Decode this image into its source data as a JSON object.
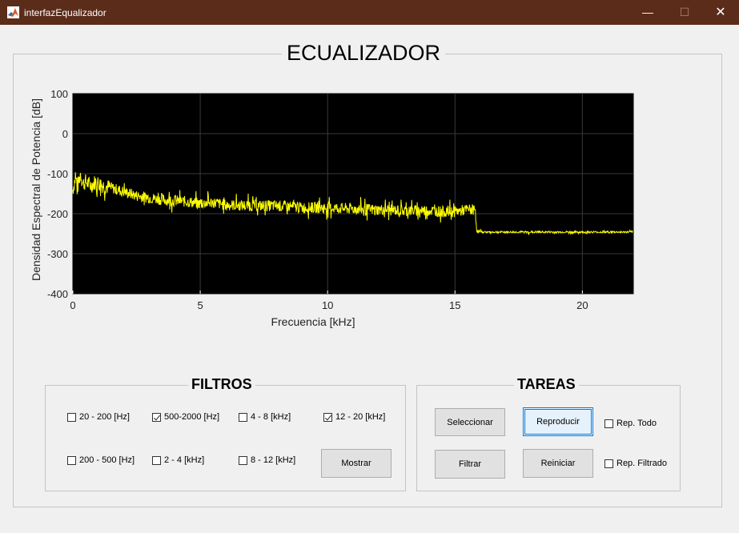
{
  "window": {
    "title": "interfazEqualizador",
    "minimize_icon": "—",
    "maximize_icon": "☐",
    "close_icon": "✕"
  },
  "main_title": "ECUALIZADOR",
  "chart_data": {
    "type": "line",
    "xlabel": "Frecuencia [kHz]",
    "ylabel": "Densidad Espectral de Potencia [dB]",
    "xlim": [
      0,
      22
    ],
    "ylim": [
      -400,
      100
    ],
    "xticks": [
      0,
      5,
      10,
      15,
      20
    ],
    "yticks": [
      100,
      0,
      -100,
      -200,
      -300,
      -400
    ],
    "grid": true,
    "background": "#000000",
    "line_color": "#ffff00",
    "series": [
      {
        "x": [
          0,
          0.1,
          0.2,
          0.3,
          0.4,
          0.5,
          0.7,
          0.9,
          1.2,
          1.5,
          2,
          2.5,
          3,
          3.5,
          4,
          4.5,
          5,
          5.5,
          6,
          7,
          8,
          9,
          10,
          11,
          12,
          13,
          14,
          14.5,
          15,
          15.5,
          15.8,
          15.85,
          15.9,
          16,
          16.2,
          16.5,
          17,
          18,
          19,
          20,
          21,
          22
        ],
        "y": [
          -140,
          -110,
          -130,
          -100,
          -125,
          -120,
          -130,
          -120,
          -130,
          -135,
          -145,
          -155,
          -160,
          -165,
          -168,
          -170,
          -175,
          -172,
          -178,
          -180,
          -180,
          -185,
          -185,
          -188,
          -190,
          -192,
          -192,
          -195,
          -195,
          -190,
          -190,
          -240,
          -245,
          -245,
          -246,
          -246,
          -246,
          -246,
          -246,
          -246,
          -246,
          -246
        ]
      }
    ]
  },
  "filtros": {
    "title": "FILTROS",
    "checkboxes": [
      {
        "label": "20 - 200 [Hz]",
        "checked": false
      },
      {
        "label": "500-2000 [Hz]",
        "checked": true
      },
      {
        "label": "4 - 8 [kHz]",
        "checked": false
      },
      {
        "label": "12 - 20 [kHz]",
        "checked": true
      },
      {
        "label": "200 - 500 [Hz]",
        "checked": false
      },
      {
        "label": "2 - 4 [kHz]",
        "checked": false
      },
      {
        "label": "8 - 12 [kHz]",
        "checked": false
      }
    ],
    "mostrar_label": "Mostrar"
  },
  "tareas": {
    "title": "TAREAS",
    "seleccionar_label": "Seleccionar",
    "reproducir_label": "Reproducir",
    "filtrar_label": "Filtrar",
    "reiniciar_label": "Reiniciar",
    "rep_todo": {
      "label": "Rep. Todo",
      "checked": false
    },
    "rep_filtrado": {
      "label": "Rep. Filtrado",
      "checked": false
    }
  }
}
